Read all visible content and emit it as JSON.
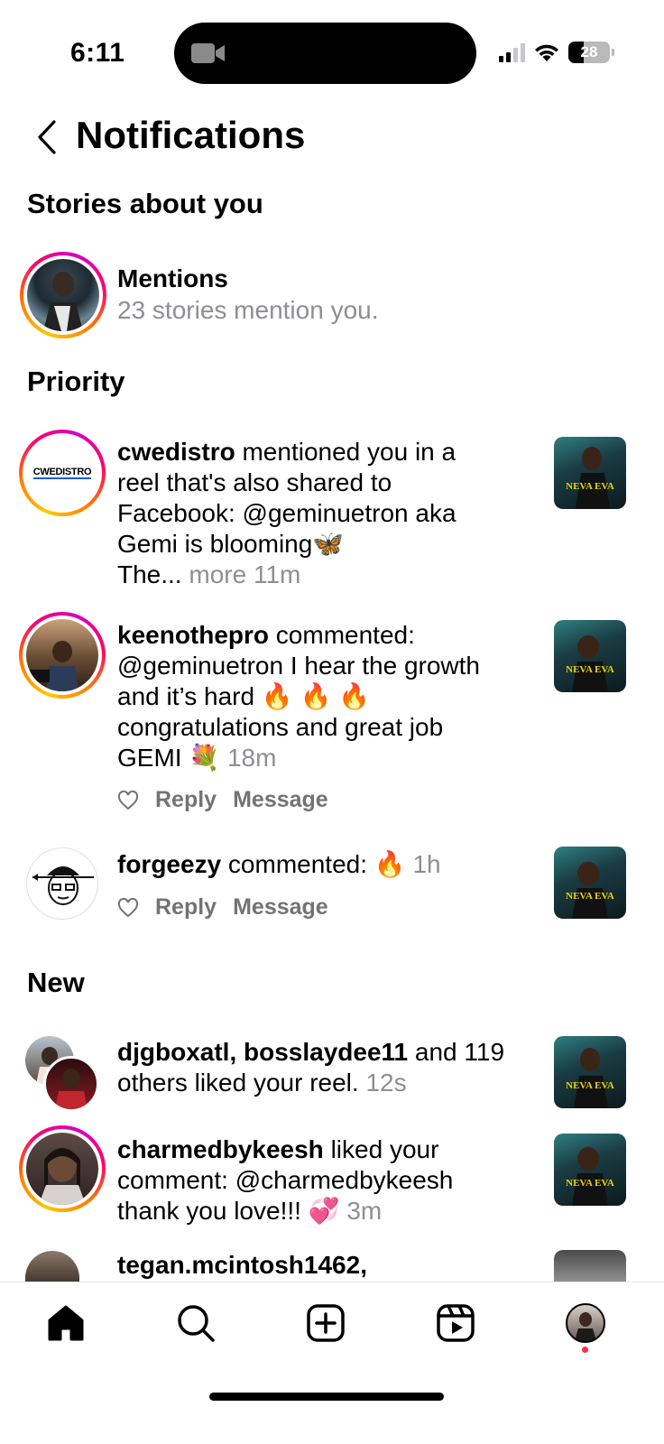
{
  "status": {
    "time": "6:11",
    "battery": "28"
  },
  "header": {
    "title": "Notifications"
  },
  "sections": {
    "stories": "Stories about you",
    "priority": "Priority",
    "new": "New"
  },
  "mentions": {
    "title": "Mentions",
    "subtitle": "23 stories mention you."
  },
  "priority": [
    {
      "user": "cwedistro",
      "lines": [
        " mentioned you in a",
        "reel that's also shared to",
        "Facebook: @geminuetron aka",
        "Gemi is blooming🦋",
        "The..."
      ],
      "more": "more",
      "time": "11m",
      "avatar_text": "CWEDISTRO"
    },
    {
      "user": "keenothepro",
      "lines": [
        " commented:",
        "@geminuetron I hear the growth",
        "and it’s hard 🔥 🔥 🔥",
        "congratulations and great job",
        "GEMI 💐"
      ],
      "time": "18m",
      "reply": "Reply",
      "message": "Message"
    },
    {
      "user": "forgeezy",
      "text": " commented: 🔥",
      "time": "1h",
      "reply": "Reply",
      "message": "Message"
    }
  ],
  "new": [
    {
      "users": "djgboxatl, bosslaydee11",
      "line1_rest": " and 119",
      "line2": "others liked your reel.",
      "time": "12s"
    },
    {
      "user": "charmedbykeesh",
      "line1_rest": " liked your",
      "line2": "comment: @charmedbykeesh",
      "line3": "thank you love!!! 💞",
      "time": "3m"
    },
    {
      "user": "tegan.mcintosh1462,"
    }
  ],
  "thumb_text": "NEVA EVA",
  "colors": {
    "accent_ring": "#ff0069",
    "grey_text": "#8e8e93",
    "action_text": "#737373",
    "notif_dot": "#ff3040"
  },
  "icons": [
    "home-icon",
    "search-icon",
    "create-icon",
    "reels-icon",
    "profile-avatar"
  ]
}
